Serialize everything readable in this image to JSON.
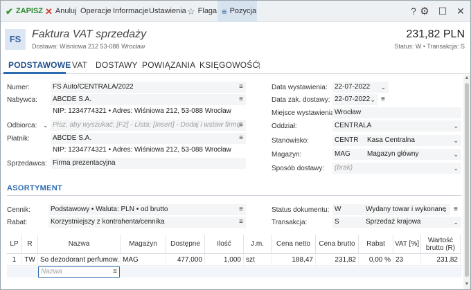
{
  "toolbar": {
    "save": "ZAPISZ",
    "cancel": "Anuluj",
    "operations": "Operacje",
    "info": "Informacje",
    "settings": "Ustawienia",
    "flag": "Flaga",
    "position": "Pozycja"
  },
  "header": {
    "badge": "FS",
    "title": "Faktura VAT sprzedaży",
    "delivery": "Dostawa: Wiśniowa 212 53-088 Wrocław",
    "amount": "231,82 PLN",
    "status": "Status: W  •  Transakcja: S"
  },
  "tabs": [
    "PODSTAWOWE",
    "VAT",
    "DOSTAWY",
    "POWIĄZANIA",
    "KSIĘGOWOŚĆ"
  ],
  "form_left": {
    "numer_label": "Numer:",
    "numer_value": "FS Auto/CENTRALA/2022",
    "nabywca_label": "Nabywca:",
    "nabywca_value": "ABCDE S.A.",
    "nabywca_details": "NIP: 1234774321  •  Adres: Wiśniowa 212, 53-088 Wrocław",
    "odbiorca_label": "Odbiorca:",
    "odbiorca_placeholder": "Pisz, aby wyszukać; [F2] - Lista; [Insert] - Dodaj i wstaw firmę;",
    "platnik_label": "Płatnik:",
    "platnik_value": "ABCDE S.A.",
    "platnik_details": "NIP: 1234774321  •  Adres: Wiśniowa 212, 53-088 Wrocław",
    "sprzedawca_label": "Sprzedawca:",
    "sprzedawca_value": "Firma prezentacyjna"
  },
  "form_right": {
    "data_wyst_label": "Data wystawienia:",
    "data_wyst_value": "22-07-2022",
    "data_zak_label": "Data zak. dostawy:",
    "data_zak_value": "22-07-2022",
    "miejsce_label": "Miejsce wystawienia:",
    "miejsce_value": "Wrocław",
    "oddzial_label": "Oddział:",
    "oddzial_value": "CENTRALA",
    "stanowisko_label": "Stanowisko:",
    "stanowisko_code": "CENTR",
    "stanowisko_name": "Kasa Centralna",
    "magazyn_label": "Magazyn:",
    "magazyn_code": "MAG",
    "magazyn_name": "Magazyn główny",
    "sposob_label": "Sposób dostawy:",
    "sposob_placeholder": "(brak)"
  },
  "asortyment": {
    "title": "ASORTYMENT",
    "cennik_label": "Cennik:",
    "cennik_value": "Podstawowy • Waluta: PLN • od brutto",
    "rabat_label": "Rabat:",
    "rabat_value": "Korzystniejszy z kontrahenta/cennika",
    "status_label": "Status dokumentu:",
    "status_code": "W",
    "status_name": "Wydany towar i wykonane",
    "transakcja_label": "Transakcja:",
    "transakcja_code": "S",
    "transakcja_name": "Sprzedaż krajowa"
  },
  "table": {
    "headers": [
      "LP",
      "R",
      "Nazwa",
      "Magazyn",
      "Dostępne",
      "Ilość",
      "J.m.",
      "Cena netto",
      "Cena brutto",
      "Rabat",
      "VAT [%]",
      "Wartość brutto (R)"
    ],
    "rows": [
      {
        "lp": "1",
        "r": "TW",
        "nazwa": "So dezodorant perfumow...",
        "magazyn": "MAG",
        "dostepne": "477,000",
        "ilosc": "1,000",
        "jm": "szt",
        "cena_netto": "188,47",
        "cena_brutto": "231,82",
        "rabat": "0,00 %",
        "vat": "23",
        "wartosc": "231,82"
      }
    ],
    "new_row_placeholder": "Nazwa"
  }
}
